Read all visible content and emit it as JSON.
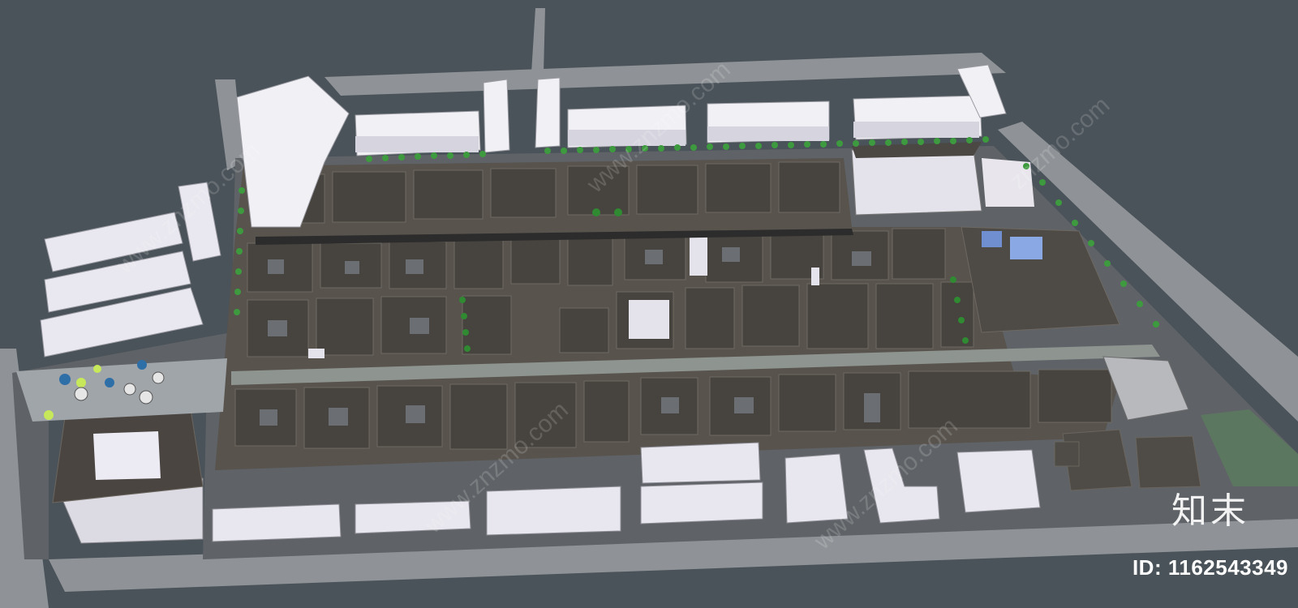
{
  "brand": {
    "logo_text": "知末"
  },
  "image_id": {
    "label": "ID: 1162543349"
  },
  "watermarks": [
    "www.znzmo.com",
    "www.znzmo.com",
    "znzmo.com",
    "www.znzmo.com",
    "www.znzmo.com"
  ],
  "colors": {
    "background": "#4a5359",
    "road": "#969a9e",
    "ground": "#5f6367",
    "roof": "#5b5650",
    "roof_dark": "#46423d",
    "white_block": "#eceaf2",
    "tree": "#3e9a3e",
    "plaza": "#9fa4a8"
  }
}
